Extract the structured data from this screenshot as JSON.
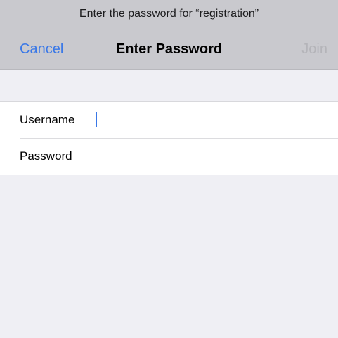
{
  "header": {
    "prompt": "Enter the password for “registration”",
    "cancel_label": "Cancel",
    "title": "Enter Password",
    "join_label": "Join"
  },
  "form": {
    "username": {
      "label": "Username",
      "value": ""
    },
    "password": {
      "label": "Password",
      "value": ""
    }
  },
  "colors": {
    "accent": "#3a78e7",
    "disabled": "#b4b4b9",
    "header_bg": "#c9c9ce",
    "page_bg": "#efeff4"
  }
}
